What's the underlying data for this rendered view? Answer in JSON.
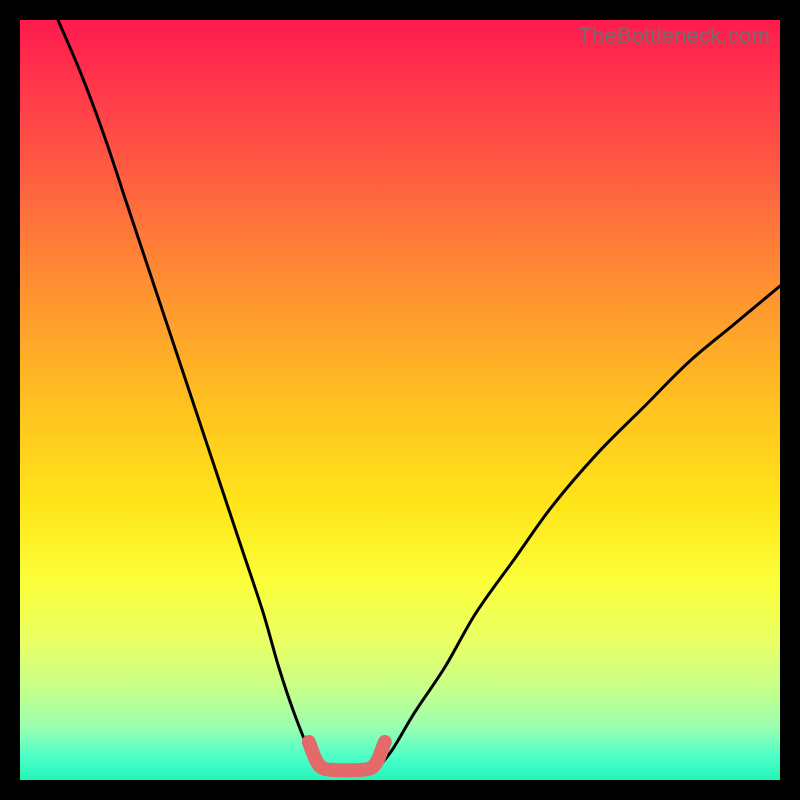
{
  "watermark": "TheBottleneck.com",
  "colors": {
    "background": "#000000",
    "curve": "#000000",
    "highlight": "#e46a6a",
    "gradient_top": "#ff1a4e",
    "gradient_bottom": "#22f5b9"
  },
  "chart_data": {
    "type": "line",
    "title": "",
    "xlabel": "",
    "ylabel": "",
    "xlim": [
      0,
      100
    ],
    "ylim": [
      0,
      100
    ],
    "note": "Stylized bottleneck V-curve over a red→green vertical gradient. No axis ticks or numeric labels are rendered. X represents some resource ratio; Y represents bottleneck severity (top=high/red, bottom=low/green). Values below are estimated from curve geometry.",
    "series": [
      {
        "name": "left-branch",
        "x": [
          5,
          8,
          11,
          14,
          17,
          20,
          23,
          26,
          29,
          32,
          34,
          36,
          38,
          39.5
        ],
        "y": [
          100,
          93,
          85,
          76,
          67,
          58,
          49,
          40,
          31,
          22,
          15,
          9,
          4,
          1.5
        ]
      },
      {
        "name": "right-branch",
        "x": [
          47,
          49,
          52,
          56,
          60,
          65,
          70,
          76,
          82,
          88,
          94,
          100
        ],
        "y": [
          1.5,
          4,
          9,
          15,
          22,
          29,
          36,
          43,
          49,
          55,
          60,
          65
        ]
      },
      {
        "name": "valley-highlight",
        "x": [
          38,
          39,
          40,
          42,
          44,
          46,
          47,
          48
        ],
        "y": [
          5,
          2.5,
          1.5,
          1.3,
          1.3,
          1.5,
          2.5,
          5
        ]
      }
    ]
  }
}
